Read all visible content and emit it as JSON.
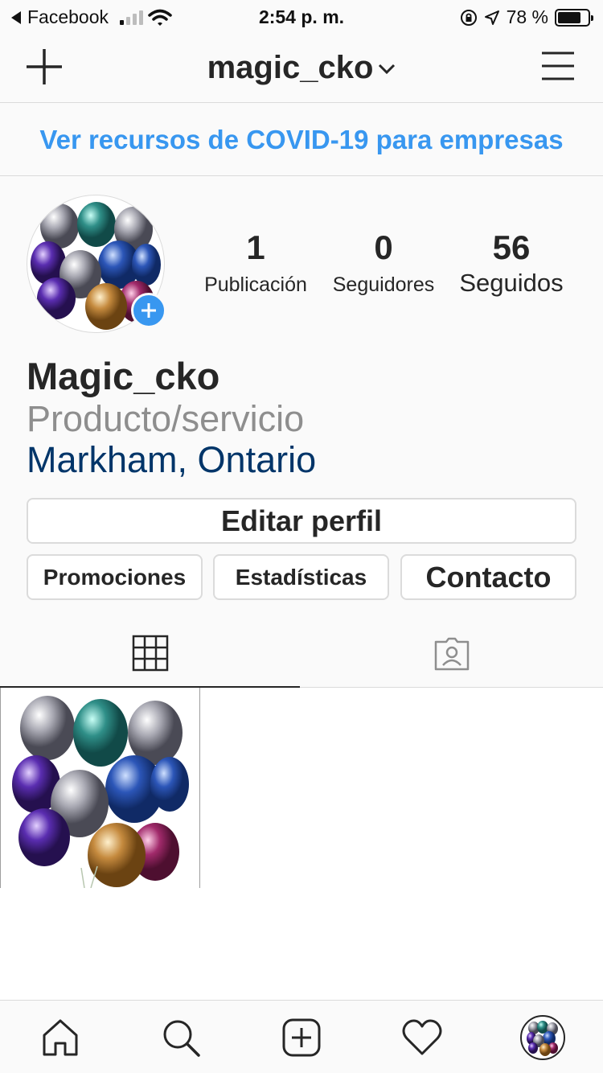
{
  "status_bar": {
    "back_app": "Facebook",
    "time": "2:54 p. m.",
    "battery_pct_text": "78 %",
    "battery_level": 0.78
  },
  "header": {
    "username": "magic_cko"
  },
  "banner": {
    "text": "Ver recursos de COVID-19 para empresas"
  },
  "profile": {
    "stats": [
      {
        "count": "1",
        "label": "Publicación"
      },
      {
        "count": "0",
        "label": "Seguidores"
      },
      {
        "count": "56",
        "label": "Seguidos"
      }
    ],
    "name": "Magic_cko",
    "category": "Producto/servicio",
    "location": "Markham, Ontario"
  },
  "actions": {
    "edit_profile": "Editar perfil",
    "promotions": "Promociones",
    "insights": "Estadísticas",
    "contact": "Contacto"
  },
  "tabs": {
    "active": "grid",
    "items": [
      "grid-icon",
      "tagged-icon"
    ]
  },
  "bottom_nav": {
    "items": [
      "home-icon",
      "search-icon",
      "new-post-icon",
      "heart-icon",
      "profile-avatar"
    ]
  },
  "colors": {
    "link_blue": "#3897f0",
    "location_blue": "#003569",
    "category_gray": "#8e8e8e",
    "text": "#262626",
    "divider": "#dbdbdb"
  }
}
